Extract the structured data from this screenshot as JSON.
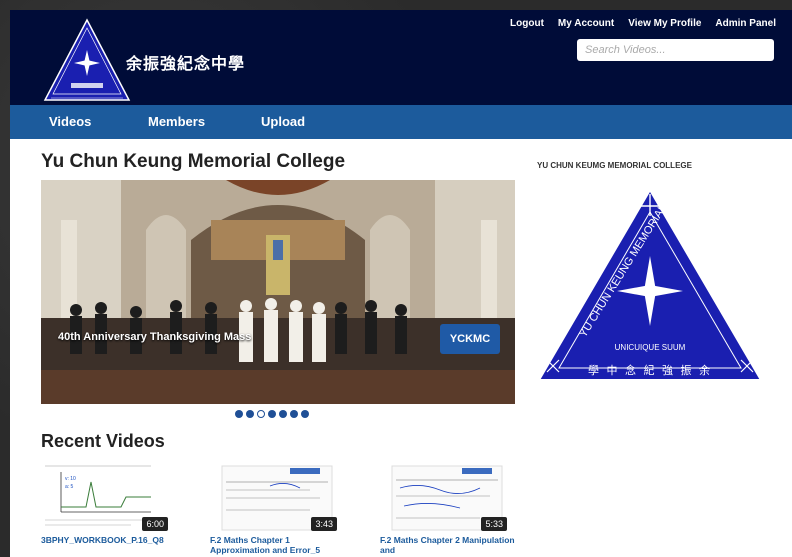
{
  "header": {
    "site_name": "余振強紀念中學",
    "logo_alt": "school-crest",
    "links": [
      "Logout",
      "My Account",
      "View My Profile",
      "Admin Panel"
    ],
    "search_placeholder": "Search Videos..."
  },
  "nav": {
    "items": [
      "Videos",
      "Members",
      "Upload"
    ]
  },
  "main": {
    "title": "Yu Chun Keung Memorial College",
    "carousel": {
      "caption": "40th Anniversary Thanksgiving Mass",
      "button_label": "YCKMC",
      "slide_count": 7,
      "active_index": 2
    },
    "recent_title": "Recent Videos",
    "videos": [
      {
        "title": "3BPHY_WORKBOOK_P.16_Q8",
        "duration": "6:00"
      },
      {
        "title": "F.2 Maths Chapter 1 Approximation and Error_5",
        "duration": "3:43"
      },
      {
        "title": "F.2 Maths Chapter 2 Manipulation and",
        "duration": "5:33"
      }
    ]
  },
  "sidebar": {
    "title": "YU CHUN KEUMG MEMORIAL COLLEGE",
    "crest_text": "YU CHUN KEUNG MEMORIAL COLLEGE",
    "crest_motto": "UNICUIQUE SUUM",
    "crest_chinese": "學 中 念 紀 強 振 余"
  },
  "colors": {
    "header_bg": "#000c38",
    "nav_bg": "#1c5b9c",
    "crest_blue": "#1a1fb0",
    "accent": "#1f5aa6"
  }
}
